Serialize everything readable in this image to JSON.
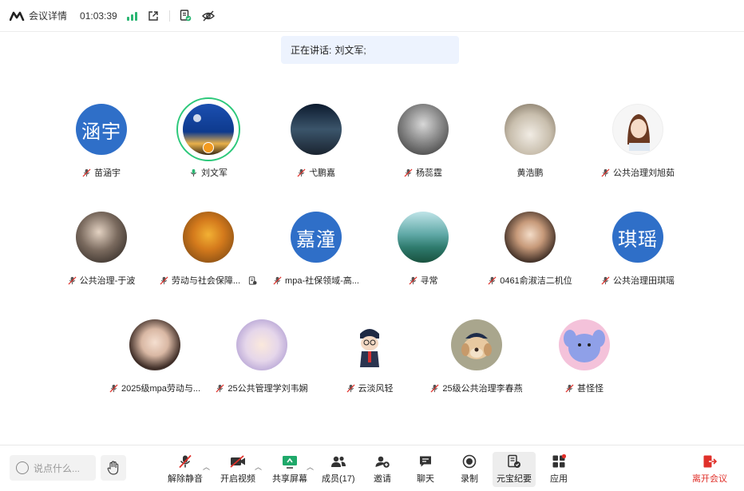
{
  "topbar": {
    "title": "会议详情",
    "timer": "01:03:39"
  },
  "speaking": {
    "label": "正在讲话:",
    "names": "刘文军;"
  },
  "participants": [
    {
      "name": "苗涵宇",
      "avatar_text": "涵宇"
    },
    {
      "name": "刘文军"
    },
    {
      "name": "弋鹏嘉"
    },
    {
      "name": "杨蕊霆"
    },
    {
      "name": "黄浩鹏"
    },
    {
      "name": "公共治理刘旭茹"
    },
    {
      "name": "公共治理-于波"
    },
    {
      "name": "劳动与社会保障..."
    },
    {
      "name": "mpa-社保领域-高...",
      "avatar_text": "嘉潼"
    },
    {
      "name": "寻常"
    },
    {
      "name": "0461俞淑洁二机位"
    },
    {
      "name": "公共治理田琪瑶",
      "avatar_text": "琪瑶"
    },
    {
      "name": "2025级mpa劳动与..."
    },
    {
      "name": "25公共管理学刘韦娴"
    },
    {
      "name": "云淡风轻"
    },
    {
      "name": "25级公共治理李春燕"
    },
    {
      "name": "甚怪怪"
    }
  ],
  "bottombar": {
    "chat_placeholder": "说点什么...",
    "unmute": "解除静音",
    "video": "开启视频",
    "share": "共享屏幕",
    "members": "成员(17)",
    "invite": "邀请",
    "chat": "聊天",
    "record": "录制",
    "yuanbao": "元宝纪要",
    "apps": "应用",
    "leave": "离开会议"
  },
  "colors": {
    "accent_green": "#2bb673",
    "avatar_blue": "#2f6fc8",
    "leave_red": "#e0302a",
    "banner_bg": "#edf3fe"
  }
}
